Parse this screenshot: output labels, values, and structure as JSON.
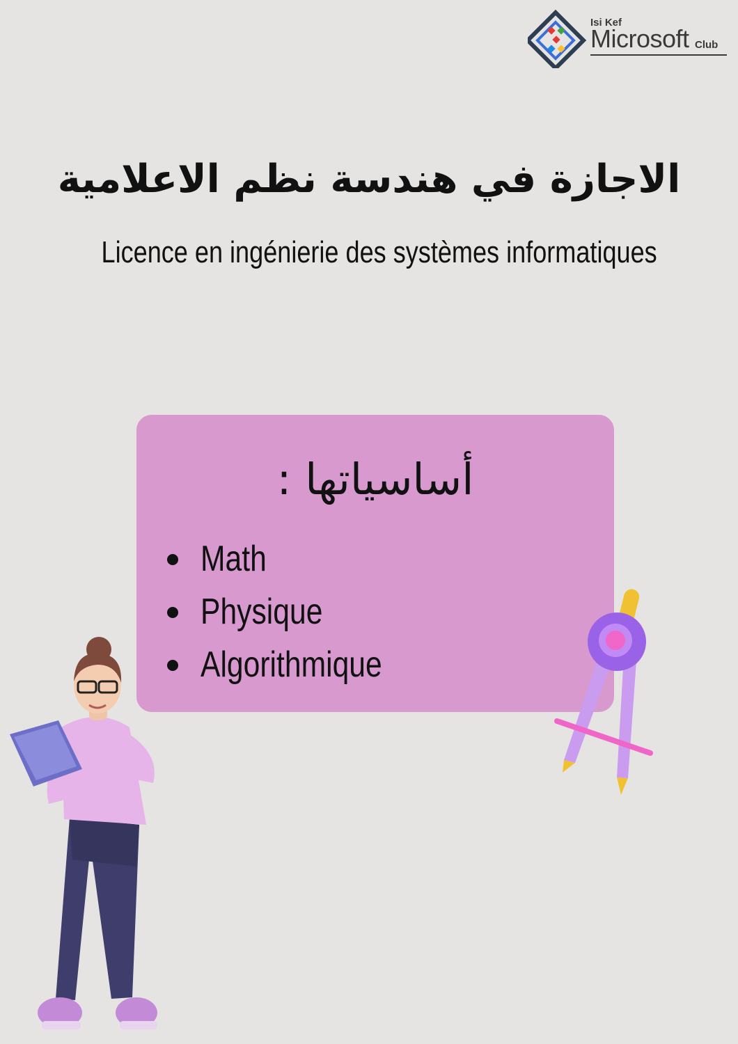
{
  "logo": {
    "small": "Isi Kef",
    "big": "Microsoft",
    "club": "Club"
  },
  "title_ar": "الاجازة في هندسة نظم الاعلامية",
  "title_fr": "Licence en ingénierie des systèmes informatiques",
  "card": {
    "heading": "أساسياتها :",
    "items": [
      {
        "label": "Math"
      },
      {
        "label": "Physique"
      },
      {
        "label": "Algorithmique"
      }
    ]
  },
  "colors": {
    "background": "#e6e4e2",
    "card": "#d899cf",
    "text": "#111111"
  }
}
